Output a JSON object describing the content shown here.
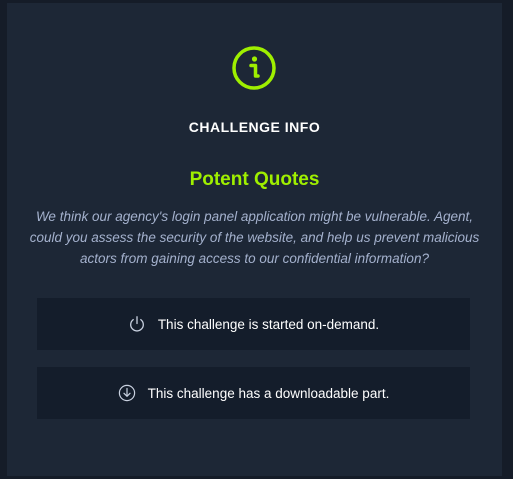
{
  "modal": {
    "icon": "info-circle-icon",
    "title": "CHALLENGE INFO",
    "challenge_name": "Potent Quotes",
    "description": "We think our agency's login panel application might be vulnerable. Agent, could you assess the security of the website, and help us prevent malicious actors from gaining access to our confidential information?"
  },
  "features": [
    {
      "icon": "power-icon",
      "text": "This challenge is started on-demand."
    },
    {
      "icon": "download-icon",
      "text": "This challenge has a downloadable part."
    }
  ],
  "colors": {
    "accent": "#9fef00",
    "modal_bg": "#1d2736",
    "card_bg": "#141d2b",
    "text_muted": "#a4b1cd"
  }
}
